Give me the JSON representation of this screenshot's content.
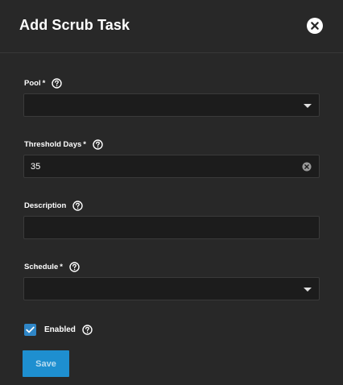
{
  "dialog": {
    "title": "Add Scrub Task",
    "close_icon": "close-icon"
  },
  "fields": {
    "pool": {
      "label": "Pool",
      "required_mark": "*",
      "value": "",
      "help_icon": "help-icon",
      "control": "select"
    },
    "threshold_days": {
      "label": "Threshold Days",
      "required_mark": "*",
      "value": "35",
      "help_icon": "help-icon",
      "clear_icon": "clear-icon",
      "control": "input"
    },
    "description": {
      "label": "Description",
      "value": "",
      "help_icon": "help-icon",
      "control": "input"
    },
    "schedule": {
      "label": "Schedule",
      "required_mark": "*",
      "value": "",
      "help_icon": "help-icon",
      "control": "select"
    }
  },
  "enabled": {
    "label": "Enabled",
    "checked": true,
    "help_icon": "help-icon"
  },
  "actions": {
    "save_label": "Save"
  },
  "colors": {
    "background": "#282828",
    "input_background": "#1c1c1c",
    "accent": "#1e8fd0",
    "checkbox": "#2f86c7"
  }
}
